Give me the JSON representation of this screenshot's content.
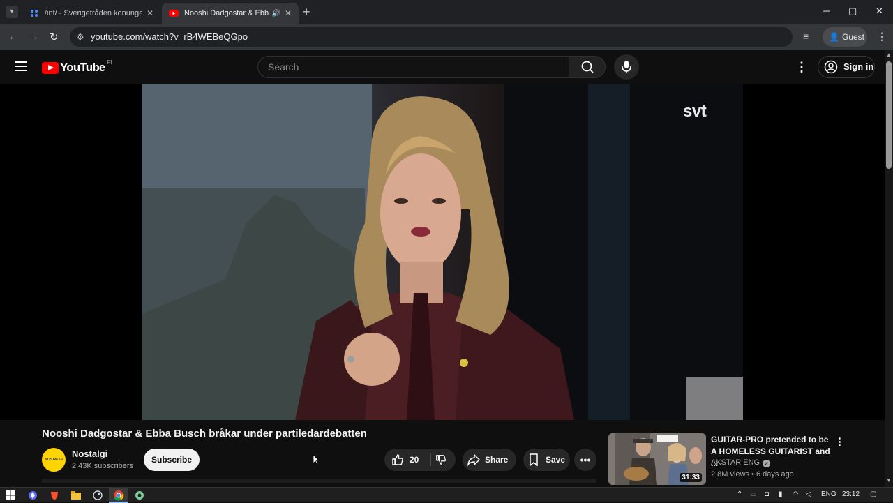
{
  "browser": {
    "tabs": [
      {
        "title": "/int/ - Sverigetråden konungen",
        "active": false
      },
      {
        "title": "Nooshi Dadgostar & Ebba",
        "active": true,
        "audio": true
      }
    ],
    "url": "youtube.com/watch?v=rB4WEBeQGpo",
    "profile_label": "Guest"
  },
  "youtube": {
    "logo_text": "YouTube",
    "country_code": "FI",
    "search_placeholder": "Search",
    "signin_label": "Sign in"
  },
  "video": {
    "watermark": "svt",
    "title": "Nooshi Dadgostar & Ebba Busch bråkar under partiledardebatten",
    "channel": {
      "name": "Nostalgi",
      "subscribers": "2.43K subscribers",
      "avatar_text": "NOSTALGI"
    },
    "subscribe_label": "Subscribe",
    "like_count": "20",
    "share_label": "Share",
    "save_label": "Save"
  },
  "recommendation": {
    "title": "GUITAR-PRO pretended to be A HOMELESS GUITARIST and ...",
    "channel": "AKSTAR ENG",
    "meta": "2.8M views • 6 days ago",
    "duration": "31:33"
  },
  "taskbar": {
    "language": "ENG",
    "time": "23:12"
  },
  "colors": {
    "brand_red": "#ff0000",
    "background": "#0f0f0f",
    "avatar_yellow": "#ffd400"
  }
}
